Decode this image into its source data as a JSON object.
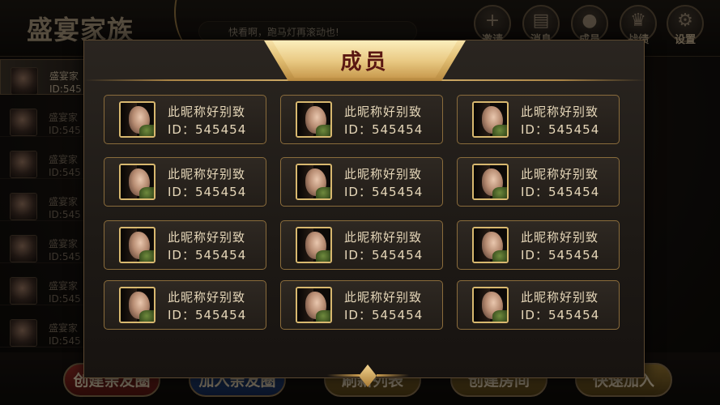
{
  "app": {
    "title": "盛宴家族",
    "marquee_text": "快看啊，跑马灯再滚动也!"
  },
  "top_buttons": [
    {
      "label": "邀请",
      "icon": "plus-icon",
      "glyph": "+"
    },
    {
      "label": "消息",
      "icon": "message-icon",
      "glyph": "▤"
    },
    {
      "label": "成员",
      "icon": "members-icon",
      "glyph": "●"
    },
    {
      "label": "战绩",
      "icon": "trophy-icon",
      "glyph": "♛"
    },
    {
      "label": "设置",
      "icon": "gear-icon",
      "glyph": "⚙"
    }
  ],
  "side_list": [
    {
      "name": "盛宴家",
      "id": "ID:545"
    },
    {
      "name": "盛宴家",
      "id": "ID:545"
    },
    {
      "name": "盛宴家",
      "id": "ID:545"
    },
    {
      "name": "盛宴家",
      "id": "ID:545"
    },
    {
      "name": "盛宴家",
      "id": "ID:545"
    },
    {
      "name": "盛宴家",
      "id": "ID:545"
    },
    {
      "name": "盛宴家",
      "id": "ID:545"
    }
  ],
  "bottom_buttons": [
    {
      "label": "创建亲友圈",
      "style": "red"
    },
    {
      "label": "加入亲友圈",
      "style": "blue"
    },
    {
      "label": "刷新列表",
      "style": "gold"
    },
    {
      "label": "创建房间",
      "style": "gold"
    },
    {
      "label": "快速加入",
      "style": "gold"
    }
  ],
  "modal": {
    "title": "成员",
    "members": [
      {
        "name": "此昵称好别致",
        "id": "ID：545454"
      },
      {
        "name": "此昵称好别致",
        "id": "ID：545454"
      },
      {
        "name": "此昵称好别致",
        "id": "ID：545454"
      },
      {
        "name": "此昵称好别致",
        "id": "ID：545454"
      },
      {
        "name": "此昵称好别致",
        "id": "ID：545454"
      },
      {
        "name": "此昵称好别致",
        "id": "ID：545454"
      },
      {
        "name": "此昵称好别致",
        "id": "ID：545454"
      },
      {
        "name": "此昵称好别致",
        "id": "ID：545454"
      },
      {
        "name": "此昵称好别致",
        "id": "ID：545454"
      },
      {
        "name": "此昵称好别致",
        "id": "ID：545454"
      },
      {
        "name": "此昵称好别致",
        "id": "ID：545454"
      },
      {
        "name": "此昵称好别致",
        "id": "ID：545454"
      }
    ]
  },
  "colors": {
    "gold_accent": "#e3c07a",
    "title_text": "#5a1712",
    "card_border": "#8a6c3c"
  }
}
